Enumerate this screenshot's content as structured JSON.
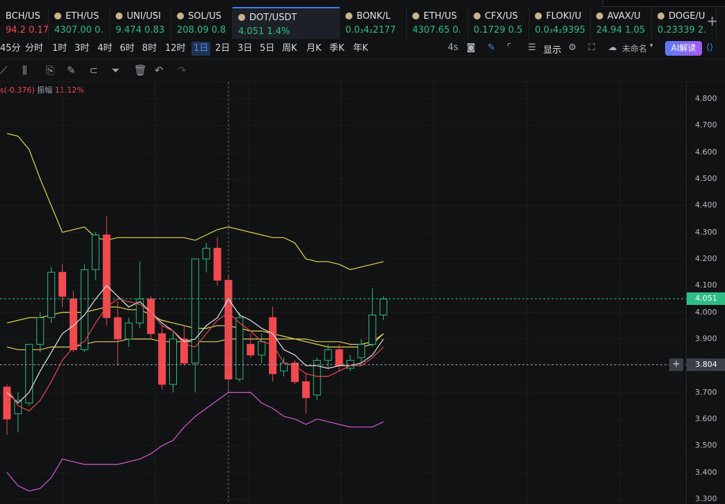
{
  "tabs": [
    {
      "name": "BCH/US",
      "price": "94.2",
      "change": "0.17",
      "dir": "dn",
      "dot": false
    },
    {
      "name": "ETH/US",
      "price": "4307.00",
      "change": "0.",
      "dir": "up",
      "dot": true
    },
    {
      "name": "UNI/USI",
      "price": "9.474",
      "change": "0.83",
      "dir": "up",
      "dot": true
    },
    {
      "name": "SOL/US",
      "price": "208.09",
      "change": "0.8",
      "dir": "up",
      "dot": true
    },
    {
      "name": "DOT/USDT",
      "price": "4.051",
      "change": "1.4%",
      "dir": "up",
      "dot": true,
      "active": true
    },
    {
      "name": "BONK/L",
      "price": "0.0₃4₂2177",
      "change": "",
      "dir": "up",
      "dot": true
    },
    {
      "name": "ETH/US",
      "price": "4307.65",
      "change": "0.",
      "dir": "up",
      "dot": true
    },
    {
      "name": "CFX/US",
      "price": "0.1729",
      "change": "0.5",
      "dir": "up",
      "dot": true
    },
    {
      "name": "FLOKI/U",
      "price": "0.0₃4₂9395",
      "change": "",
      "dir": "up",
      "dot": true
    },
    {
      "name": "AVAX/U",
      "price": "24.94",
      "change": "1.05",
      "dir": "up",
      "dot": true
    },
    {
      "name": "DOGE/U",
      "price": "0.23339",
      "change": "2.",
      "dir": "up",
      "dot": true
    }
  ],
  "add_tab": "+",
  "timeframes": [
    "45分",
    "分时",
    "1时",
    "3时",
    "4时",
    "6时",
    "8时",
    "12时",
    "1日",
    "2日",
    "3日",
    "5日",
    "周K",
    "月K",
    "季K",
    "年K"
  ],
  "selected_timeframe": "1日",
  "toolbar_right": {
    "refresh": "4s",
    "show": "显示",
    "unnamed": "未命名",
    "ai": "AI解读"
  },
  "info_bar": {
    "change": "s(-0.376)",
    "amp_label": "振幅",
    "amp_value": "11.12%"
  },
  "price_axis": {
    "ticks": [
      "4.800",
      "4.700",
      "4.600",
      "4.500",
      "4.400",
      "4.300",
      "4.200",
      "4.100",
      "4.000",
      "3.900",
      "3.800",
      "3.700",
      "3.600",
      "3.500",
      "3.400",
      "3.300"
    ],
    "last_price": "4.051",
    "cursor_price": "3.804"
  },
  "colors": {
    "up": "#2ebd85",
    "down": "#f04a4f",
    "accent": "#3b7cf6",
    "ma_yellow": "#e6d94a",
    "ma_white": "#e8e8e8",
    "ma_red": "#e64a4a",
    "boll_lower": "#d65ad6"
  },
  "chart_data": {
    "type": "candlestick",
    "ylim": [
      3.3,
      4.8
    ],
    "candles": [
      {
        "o": 3.72,
        "h": 3.73,
        "l": 3.54,
        "c": 3.6
      },
      {
        "o": 3.62,
        "h": 3.7,
        "l": 3.55,
        "c": 3.67
      },
      {
        "o": 3.66,
        "h": 3.88,
        "l": 3.65,
        "c": 3.88
      },
      {
        "o": 3.88,
        "h": 4.0,
        "l": 3.85,
        "c": 3.98
      },
      {
        "o": 3.98,
        "h": 4.17,
        "l": 3.96,
        "c": 4.15
      },
      {
        "o": 4.15,
        "h": 4.18,
        "l": 4.02,
        "c": 4.06
      },
      {
        "o": 4.05,
        "h": 4.08,
        "l": 3.85,
        "c": 3.86
      },
      {
        "o": 3.86,
        "h": 4.18,
        "l": 3.85,
        "c": 4.16
      },
      {
        "o": 4.16,
        "h": 4.3,
        "l": 4.12,
        "c": 4.29
      },
      {
        "o": 4.29,
        "h": 4.36,
        "l": 3.95,
        "c": 3.98
      },
      {
        "o": 3.98,
        "h": 4.04,
        "l": 3.8,
        "c": 3.9
      },
      {
        "o": 3.9,
        "h": 3.98,
        "l": 3.87,
        "c": 3.96
      },
      {
        "o": 3.96,
        "h": 4.19,
        "l": 3.94,
        "c": 4.05
      },
      {
        "o": 4.05,
        "h": 4.06,
        "l": 3.9,
        "c": 3.92
      },
      {
        "o": 3.92,
        "h": 3.95,
        "l": 3.71,
        "c": 3.73
      },
      {
        "o": 3.73,
        "h": 3.93,
        "l": 3.7,
        "c": 3.9
      },
      {
        "o": 3.9,
        "h": 3.95,
        "l": 3.8,
        "c": 3.81
      },
      {
        "o": 3.81,
        "h": 4.2,
        "l": 3.7,
        "c": 4.2
      },
      {
        "o": 4.2,
        "h": 4.26,
        "l": 4.15,
        "c": 4.24
      },
      {
        "o": 4.24,
        "h": 4.28,
        "l": 4.1,
        "c": 4.12
      },
      {
        "o": 4.12,
        "h": 4.14,
        "l": 3.7,
        "c": 3.75
      },
      {
        "o": 3.75,
        "h": 4.0,
        "l": 3.74,
        "c": 3.98
      },
      {
        "o": 3.88,
        "h": 3.92,
        "l": 3.83,
        "c": 3.84
      },
      {
        "o": 3.84,
        "h": 3.92,
        "l": 3.81,
        "c": 3.89
      },
      {
        "o": 3.98,
        "h": 4.02,
        "l": 3.74,
        "c": 3.77
      },
      {
        "o": 3.78,
        "h": 3.83,
        "l": 3.76,
        "c": 3.81
      },
      {
        "o": 3.81,
        "h": 3.82,
        "l": 3.73,
        "c": 3.74
      },
      {
        "o": 3.74,
        "h": 3.77,
        "l": 3.62,
        "c": 3.68
      },
      {
        "o": 3.69,
        "h": 3.83,
        "l": 3.67,
        "c": 3.82
      },
      {
        "o": 3.82,
        "h": 3.88,
        "l": 3.79,
        "c": 3.86
      },
      {
        "o": 3.86,
        "h": 3.88,
        "l": 3.78,
        "c": 3.8
      },
      {
        "o": 3.79,
        "h": 3.84,
        "l": 3.78,
        "c": 3.82
      },
      {
        "o": 3.83,
        "h": 3.9,
        "l": 3.81,
        "c": 3.88
      },
      {
        "o": 3.88,
        "h": 4.09,
        "l": 3.87,
        "c": 3.99
      },
      {
        "o": 3.99,
        "h": 4.06,
        "l": 3.97,
        "c": 4.05
      }
    ],
    "ma_white": [
      3.7,
      3.66,
      3.7,
      3.78,
      3.85,
      3.92,
      3.95,
      3.99,
      4.05,
      4.1,
      4.06,
      4.02,
      4.04,
      4.0,
      3.96,
      3.93,
      3.89,
      3.9,
      3.95,
      3.98,
      4.05,
      3.99,
      3.97,
      3.94,
      3.92,
      3.86,
      3.84,
      3.8,
      3.8,
      3.79,
      3.8,
      3.8,
      3.81,
      3.84,
      3.9
    ],
    "ma_red": [
      3.72,
      3.65,
      3.63,
      3.67,
      3.74,
      3.82,
      3.87,
      3.89,
      3.96,
      4.02,
      4.05,
      4.04,
      4.03,
      4.0,
      3.95,
      3.93,
      3.88,
      3.87,
      3.92,
      3.97,
      4.0,
      3.96,
      3.93,
      3.89,
      3.88,
      3.81,
      3.8,
      3.77,
      3.76,
      3.76,
      3.78,
      3.8,
      3.8,
      3.83,
      3.87
    ],
    "ma_yellow": [
      3.96,
      3.97,
      3.98,
      3.98,
      3.99,
      4.0,
      4.0,
      4.0,
      4.01,
      4.02,
      4.02,
      4.01,
      4.01,
      3.99,
      3.97,
      3.96,
      3.95,
      3.94,
      3.94,
      3.95,
      3.95,
      3.94,
      3.93,
      3.93,
      3.92,
      3.91,
      3.9,
      3.89,
      3.88,
      3.87,
      3.87,
      3.87,
      3.87,
      3.88,
      3.92
    ],
    "ma_yellow2": [
      3.87,
      3.86,
      3.86,
      3.86,
      3.87,
      3.87,
      3.87,
      3.88,
      3.89,
      3.89,
      3.89,
      3.9,
      3.9,
      3.9,
      3.89,
      3.89,
      3.89,
      3.89,
      3.89,
      3.89,
      3.9,
      3.9,
      3.9,
      3.9,
      3.9,
      3.9,
      3.9,
      3.9,
      3.89,
      3.89,
      3.89,
      3.88,
      3.88,
      3.89,
      3.92
    ],
    "boll_upper": [
      4.67,
      4.66,
      4.61,
      4.5,
      4.4,
      4.3,
      4.31,
      4.32,
      4.28,
      4.27,
      4.28,
      4.28,
      4.28,
      4.28,
      4.28,
      4.28,
      4.28,
      4.27,
      4.29,
      4.31,
      4.32,
      4.31,
      4.3,
      4.29,
      4.28,
      4.28,
      4.26,
      4.2,
      4.19,
      4.19,
      4.18,
      4.16,
      4.17,
      4.18,
      4.19
    ],
    "boll_lower": [
      3.4,
      3.35,
      3.33,
      3.34,
      3.38,
      3.45,
      3.44,
      3.43,
      3.43,
      3.43,
      3.43,
      3.44,
      3.45,
      3.47,
      3.5,
      3.52,
      3.57,
      3.61,
      3.64,
      3.67,
      3.7,
      3.7,
      3.7,
      3.66,
      3.64,
      3.61,
      3.6,
      3.58,
      3.6,
      3.59,
      3.58,
      3.57,
      3.57,
      3.57,
      3.59
    ]
  }
}
